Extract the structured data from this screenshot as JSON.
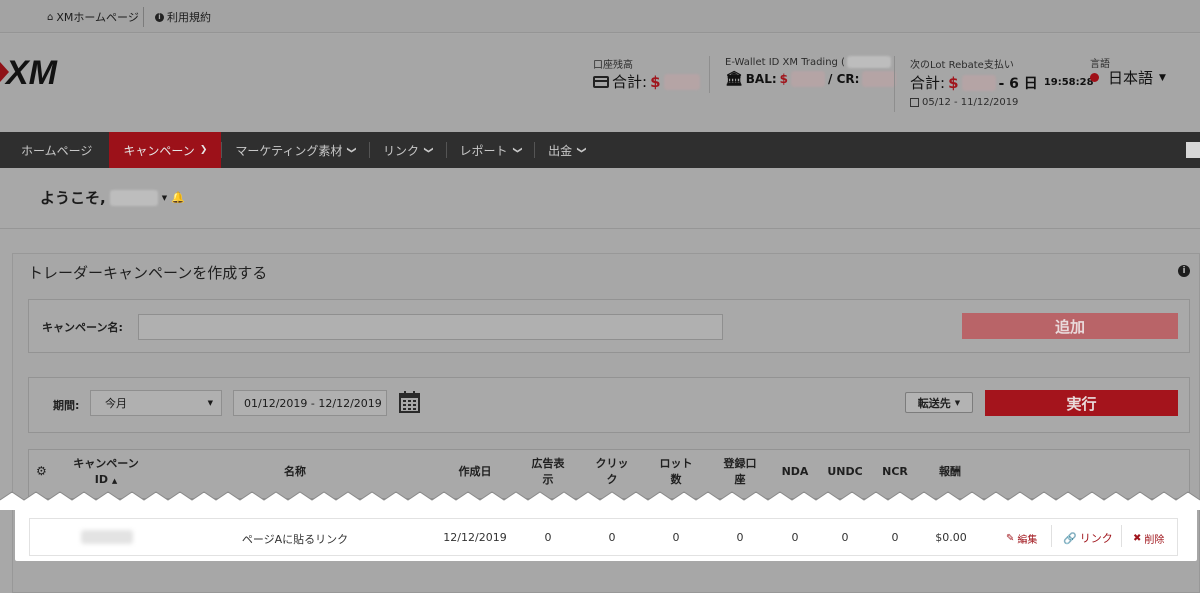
{
  "topbar": {
    "home_link": "XMホームページ",
    "terms_link": "利用規約"
  },
  "brand": {
    "logo_text": "XM"
  },
  "header": {
    "balance_label": "口座残高",
    "balance_prefix": "合計:",
    "currency": "$",
    "wallet_label": "E-Wallet ID XM Trading (",
    "bal_label": "BAL:",
    "cr_label": "/ CR:",
    "rebate_label": "次のLot Rebate支払い",
    "rebate_suffix": "- 6 日",
    "rebate_time": "19:58:28",
    "rebate_period": "05/12 - 11/12/2019",
    "language_label": "言語",
    "language_value": "日本語"
  },
  "nav": {
    "items": [
      "ホームページ",
      "キャンペーン",
      "マーケティング素材",
      "リンク",
      "レポート",
      "出金"
    ]
  },
  "welcome": {
    "greeting": "ようこそ,"
  },
  "panel": {
    "title": "トレーダーキャンペーンを作成する",
    "campaign_name_label": "キャンペーン名:",
    "add_button": "追加",
    "period_label": "期間:",
    "period_value": "今月",
    "date_range": "01/12/2019 - 12/12/2019",
    "forward_button": "転送先",
    "run_button": "実行"
  },
  "table": {
    "headers": {
      "id_line1": "キャンペーン",
      "id_line2": "ID",
      "name": "名称",
      "created": "作成日",
      "ads_line1": "広告表",
      "ads_line2": "示",
      "clicks_line1": "クリッ",
      "clicks_line2": "ク",
      "lots_line1": "ロット",
      "lots_line2": "数",
      "accounts_line1": "登録口",
      "accounts_line2": "座",
      "nda": "NDA",
      "undc": "UNDC",
      "ncr": "NCR",
      "reward": "報酬"
    },
    "rows": [
      {
        "name": "ページAに貼るリンク",
        "created": "12/12/2019",
        "ads": "0",
        "clicks": "0",
        "lots": "0",
        "accounts": "0",
        "nda": "0",
        "undc": "0",
        "ncr": "0",
        "reward": "$0.00",
        "edit": "編集",
        "link": "リンク",
        "delete": "削除"
      }
    ]
  },
  "colors": {
    "accent_red": "#a4141c",
    "nav_bg": "#2f2f2f",
    "overlay_grey": "#a8a8a8"
  }
}
